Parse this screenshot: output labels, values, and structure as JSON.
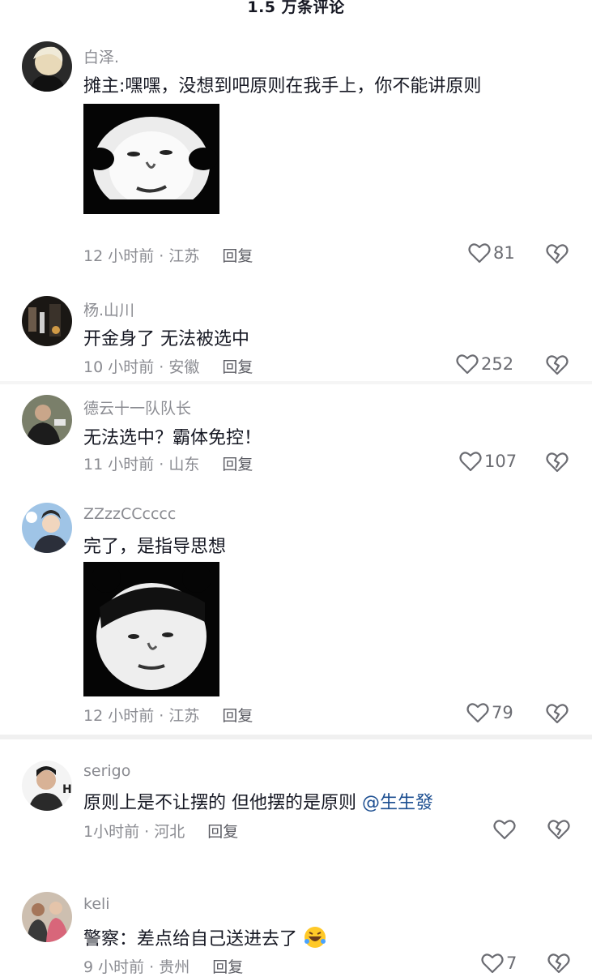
{
  "header": {
    "title": "1.5 万条评论"
  },
  "comments": [
    {
      "username": "白泽.",
      "text": "摊主:嘿嘿，没想到吧原则在我手上，你不能讲原则",
      "time": "12 小时前 · 江苏",
      "reply": "回复",
      "likes": "81"
    },
    {
      "username": "杨.山川",
      "text": "开金身了  无法被选中",
      "time": "10 小时前 · 安徽",
      "reply": "回复",
      "likes": "252"
    },
    {
      "username": "德云十一队队长",
      "text": "无法选中？霸体免控！",
      "time": "11 小时前 · 山东",
      "reply": "回复",
      "likes": "107"
    },
    {
      "username": "ZZzzCCcccc",
      "text": "完了，是指导思想",
      "time": "12 小时前 · 江苏",
      "reply": "回复",
      "likes": "79"
    },
    {
      "username": "serigo",
      "text": "原则上是不让摆的 但他摆的是原则",
      "mention": "@生生發",
      "time": "1小时前 · 河北",
      "reply": "回复",
      "likes": ""
    },
    {
      "username": "keli",
      "text": "警察：差点给自己送进去了",
      "time": "9 小时前 · 贵州",
      "reply": "回复",
      "likes": "7"
    }
  ],
  "icons": {
    "like": "heart-outline-icon",
    "dislike": "broken-heart-icon",
    "emoji": "rofl-emoji-icon"
  },
  "colors": {
    "username": "#8a8b91",
    "text": "#161823",
    "mention": "#1d4f91"
  }
}
